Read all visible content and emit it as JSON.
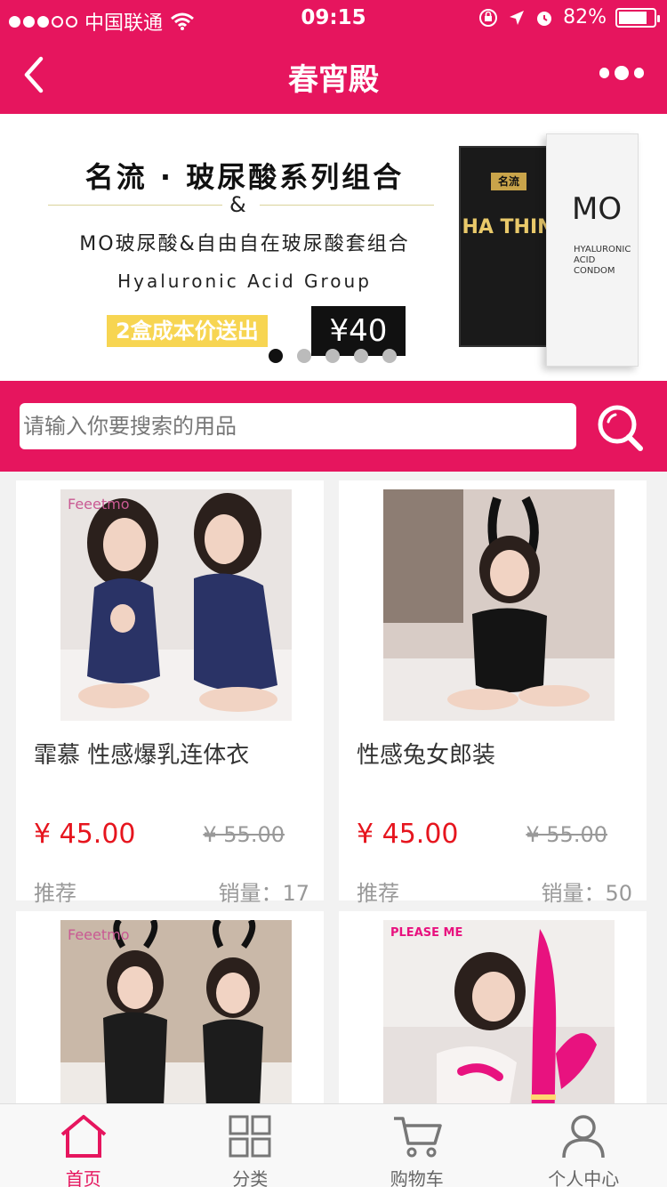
{
  "status_bar": {
    "carrier": "中国联通",
    "time": "09:15",
    "battery": "82%",
    "battery_level": 0.82,
    "signal_dots_filled": 3,
    "signal_dots_total": 5
  },
  "header": {
    "title": "春宵殿"
  },
  "banner": {
    "title": "名流 · 玻尿酸系列组合",
    "amp": "&",
    "subtitle": "MO玻尿酸&自由自在玻尿酸套组合",
    "english": "Hyaluronic Acid Group",
    "promo": "2盒成本价送出",
    "price": "¥40",
    "slides_total": 5,
    "active_slide": 1,
    "box1_label": "名流",
    "box1_text": "HA THIN",
    "box2_brand": "MO",
    "box2_text": "HYALURONIC ACID CONDOM"
  },
  "search": {
    "placeholder": "请输入你要搜索的用品"
  },
  "products": [
    {
      "name": "霏慕 性感爆乳连体衣",
      "price": "¥ 45.00",
      "old_price": "¥ 55.00",
      "tag": "推荐",
      "sales": "销量：17"
    },
    {
      "name": "性感兔女郎装",
      "price": "¥ 45.00",
      "old_price": "¥ 55.00",
      "tag": "推荐",
      "sales": "销量：50"
    },
    {
      "name": "",
      "price": "",
      "old_price": "",
      "tag": "",
      "sales": ""
    },
    {
      "name": "",
      "price": "",
      "old_price": "",
      "tag": "",
      "sales": ""
    }
  ],
  "tabbar": {
    "items": [
      {
        "label": "首页",
        "icon": "home-icon",
        "active": true
      },
      {
        "label": "分类",
        "icon": "grid-icon",
        "active": false
      },
      {
        "label": "购物车",
        "icon": "cart-icon",
        "active": false
      },
      {
        "label": "个人中心",
        "icon": "user-icon",
        "active": false
      }
    ]
  },
  "colors": {
    "brand": "#e6155e",
    "price": "#e6151e",
    "promo_bg": "#f7d552"
  }
}
